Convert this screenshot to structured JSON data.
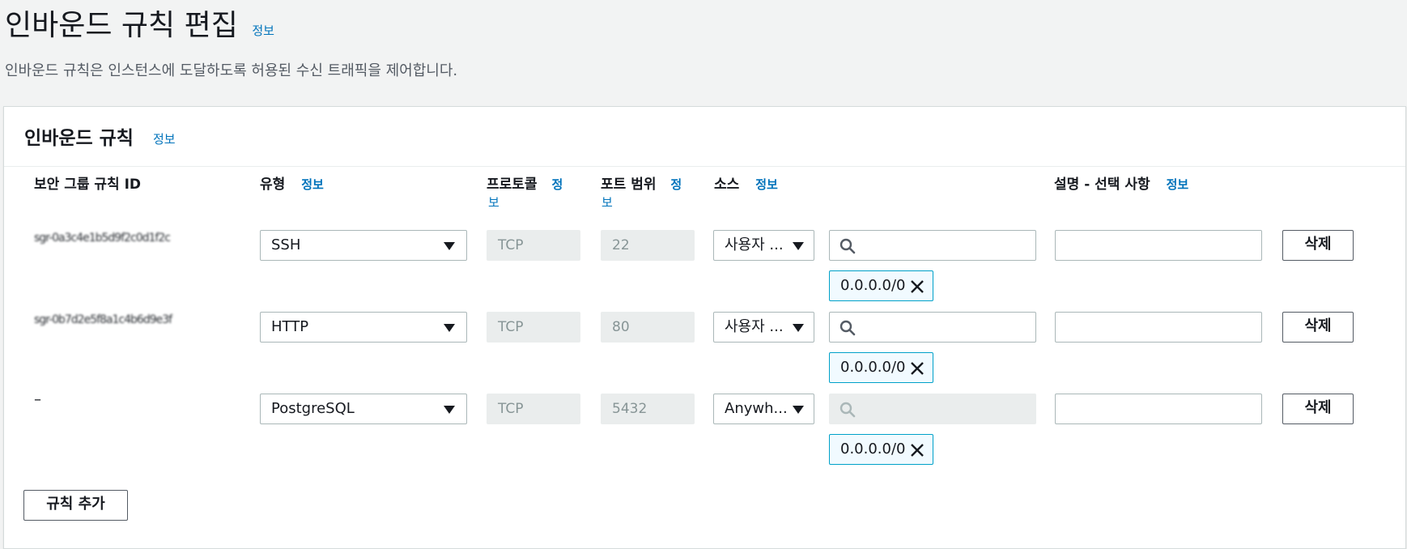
{
  "page": {
    "title": "인바운드 규칙 편집",
    "title_info": "정보",
    "description": "인바운드 규칙은 인스턴스에 도달하도록 허용된 수신 트래픽을 제어합니다."
  },
  "panel": {
    "title": "인바운드 규칙",
    "title_info": "정보"
  },
  "columns": {
    "rule_id": "보안 그룹 규칙 ID",
    "type": "유형",
    "type_info": "정보",
    "protocol": "프로토콜",
    "protocol_info_1": "정",
    "protocol_info_2": "보",
    "port_range": "포트 범위",
    "port_info_1": "정",
    "port_info_2": "보",
    "source": "소스",
    "source_info": "정보",
    "description": "설명 - 선택 사항",
    "description_info": "정보"
  },
  "rules": [
    {
      "rule_id": "sgr-0a3c4e1b5d9f2c0d1f2c",
      "type": "SSH",
      "protocol": "TCP",
      "port": "22",
      "source_type": "사용자 ...",
      "cidr": "0.0.0.0/0",
      "description": "",
      "delete_label": "삭제"
    },
    {
      "rule_id": "sgr-0b7d2e5f8a1c4b6d9e3f",
      "type": "HTTP",
      "protocol": "TCP",
      "port": "80",
      "source_type": "사용자 ...",
      "cidr": "0.0.0.0/0",
      "description": "",
      "delete_label": "삭제"
    },
    {
      "rule_id": "–",
      "type": "PostgreSQL",
      "protocol": "TCP",
      "port": "5432",
      "source_type": "Anywh...",
      "cidr": "0.0.0.0/0",
      "description": "",
      "delete_label": "삭제"
    }
  ],
  "add_rule_label": "규칙 추가",
  "icons": {
    "search": "search-icon",
    "remove": "close-icon",
    "dropdown": "caret-down-icon"
  },
  "colors": {
    "link": "#0073bb",
    "token_border": "#00a1c9",
    "token_bg": "#f1faff"
  }
}
